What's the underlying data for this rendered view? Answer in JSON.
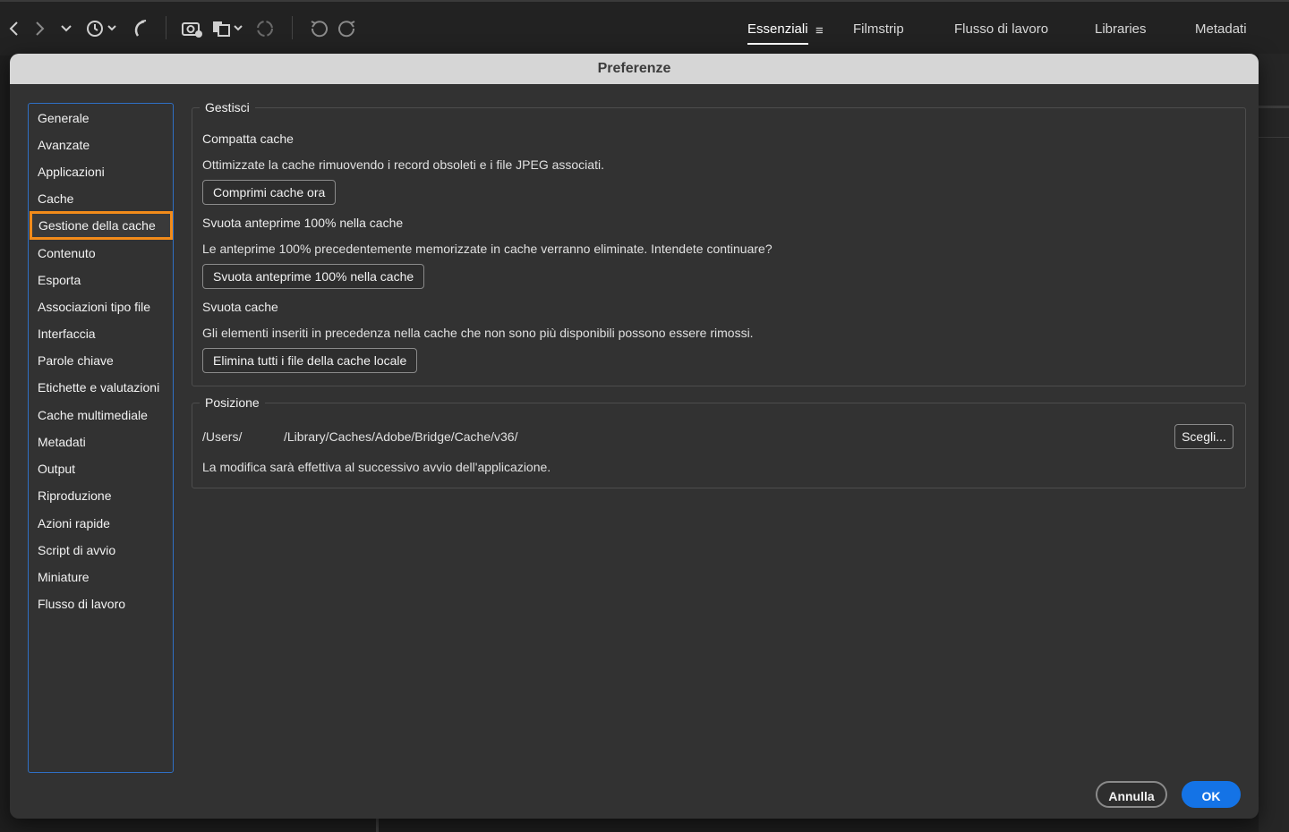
{
  "toolbar": {
    "workspaces": [
      {
        "label": "Essenziali",
        "active": true
      },
      {
        "label": "Filmstrip",
        "active": false
      },
      {
        "label": "Flusso di lavoro",
        "active": false
      },
      {
        "label": "Libraries",
        "active": false
      },
      {
        "label": "Metadati",
        "active": false
      }
    ],
    "workspace_menu_icon": "≡"
  },
  "dialog": {
    "title": "Preferenze",
    "sidebar": {
      "items": [
        {
          "label": "Generale"
        },
        {
          "label": "Avanzate"
        },
        {
          "label": "Applicazioni"
        },
        {
          "label": "Cache"
        },
        {
          "label": "Gestione della cache",
          "selected": true
        },
        {
          "label": "Contenuto"
        },
        {
          "label": "Esporta"
        },
        {
          "label": "Associazioni tipo file"
        },
        {
          "label": "Interfaccia"
        },
        {
          "label": "Parole chiave"
        },
        {
          "label": "Etichette e valutazioni"
        },
        {
          "label": "Cache multimediale"
        },
        {
          "label": "Metadati"
        },
        {
          "label": "Output"
        },
        {
          "label": "Riproduzione"
        },
        {
          "label": "Azioni rapide"
        },
        {
          "label": "Script di avvio"
        },
        {
          "label": "Miniature"
        },
        {
          "label": "Flusso di lavoro"
        }
      ]
    },
    "manage": {
      "title": "Gestisci",
      "compact": {
        "heading": "Compatta cache",
        "description": "Ottimizzate la cache rimuovendo i record obsoleti e i file JPEG associati.",
        "button": "Comprimi cache ora"
      },
      "purge_previews": {
        "heading": "Svuota anteprime 100% nella cache",
        "description": "Le anteprime 100% precedentemente memorizzate in cache verranno eliminate. Intendete continuare?",
        "button": "Svuota anteprime 100% nella cache"
      },
      "purge_cache": {
        "heading": "Svuota cache",
        "description": "Gli elementi inseriti in precedenza nella cache che non sono più disponibili possono essere rimossi.",
        "button": "Elimina tutti i file della cache locale"
      }
    },
    "location": {
      "title": "Posizione",
      "path_prefix": "/Users/",
      "path_rest": "/Library/Caches/Adobe/Bridge/Cache/v36/",
      "choose_button": "Scegli...",
      "note": "La modifica sarà effettiva al successivo avvio dell'applicazione."
    },
    "footer": {
      "cancel": "Annulla",
      "ok": "OK"
    }
  },
  "colors": {
    "selection_outline": "#f28b1a",
    "sidebar_border": "#2f6fc4",
    "ok_button": "#1473e6"
  }
}
